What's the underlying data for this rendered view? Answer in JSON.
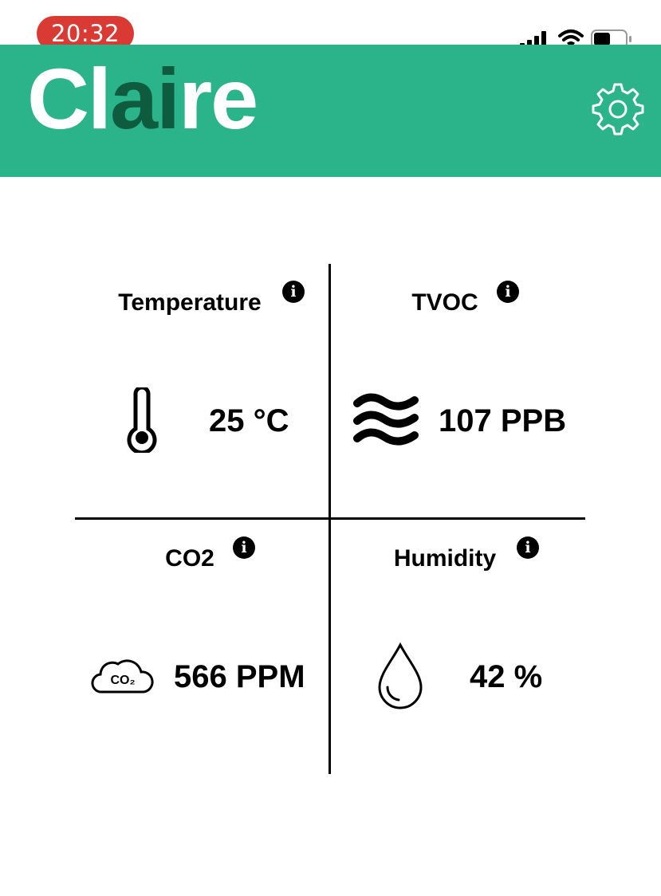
{
  "status_bar": {
    "time": "20:32",
    "time_pill_color": "#d93a34",
    "icons": [
      "cellular-signal-icon",
      "wifi-icon",
      "battery-icon"
    ]
  },
  "header": {
    "brand_prefix": "Cl",
    "brand_middle": "ai",
    "brand_suffix": "re",
    "background_color": "#2bb38a",
    "brand_light_color": "#ffffff",
    "brand_dark_color": "#0f5b40",
    "settings_icon": "gear-icon"
  },
  "metrics": {
    "temperature": {
      "title": "Temperature",
      "value": "25 °C",
      "icon": "thermometer-icon"
    },
    "tvoc": {
      "title": "TVOC",
      "value": "107 PPB",
      "icon": "waves-icon"
    },
    "co2": {
      "title": "CO2",
      "value": "566 PPM",
      "icon": "co2-cloud-icon",
      "icon_text": "CO₂"
    },
    "humidity": {
      "title": "Humidity",
      "value": "42 %",
      "icon": "water-drop-icon"
    }
  },
  "info_glyph": "i"
}
